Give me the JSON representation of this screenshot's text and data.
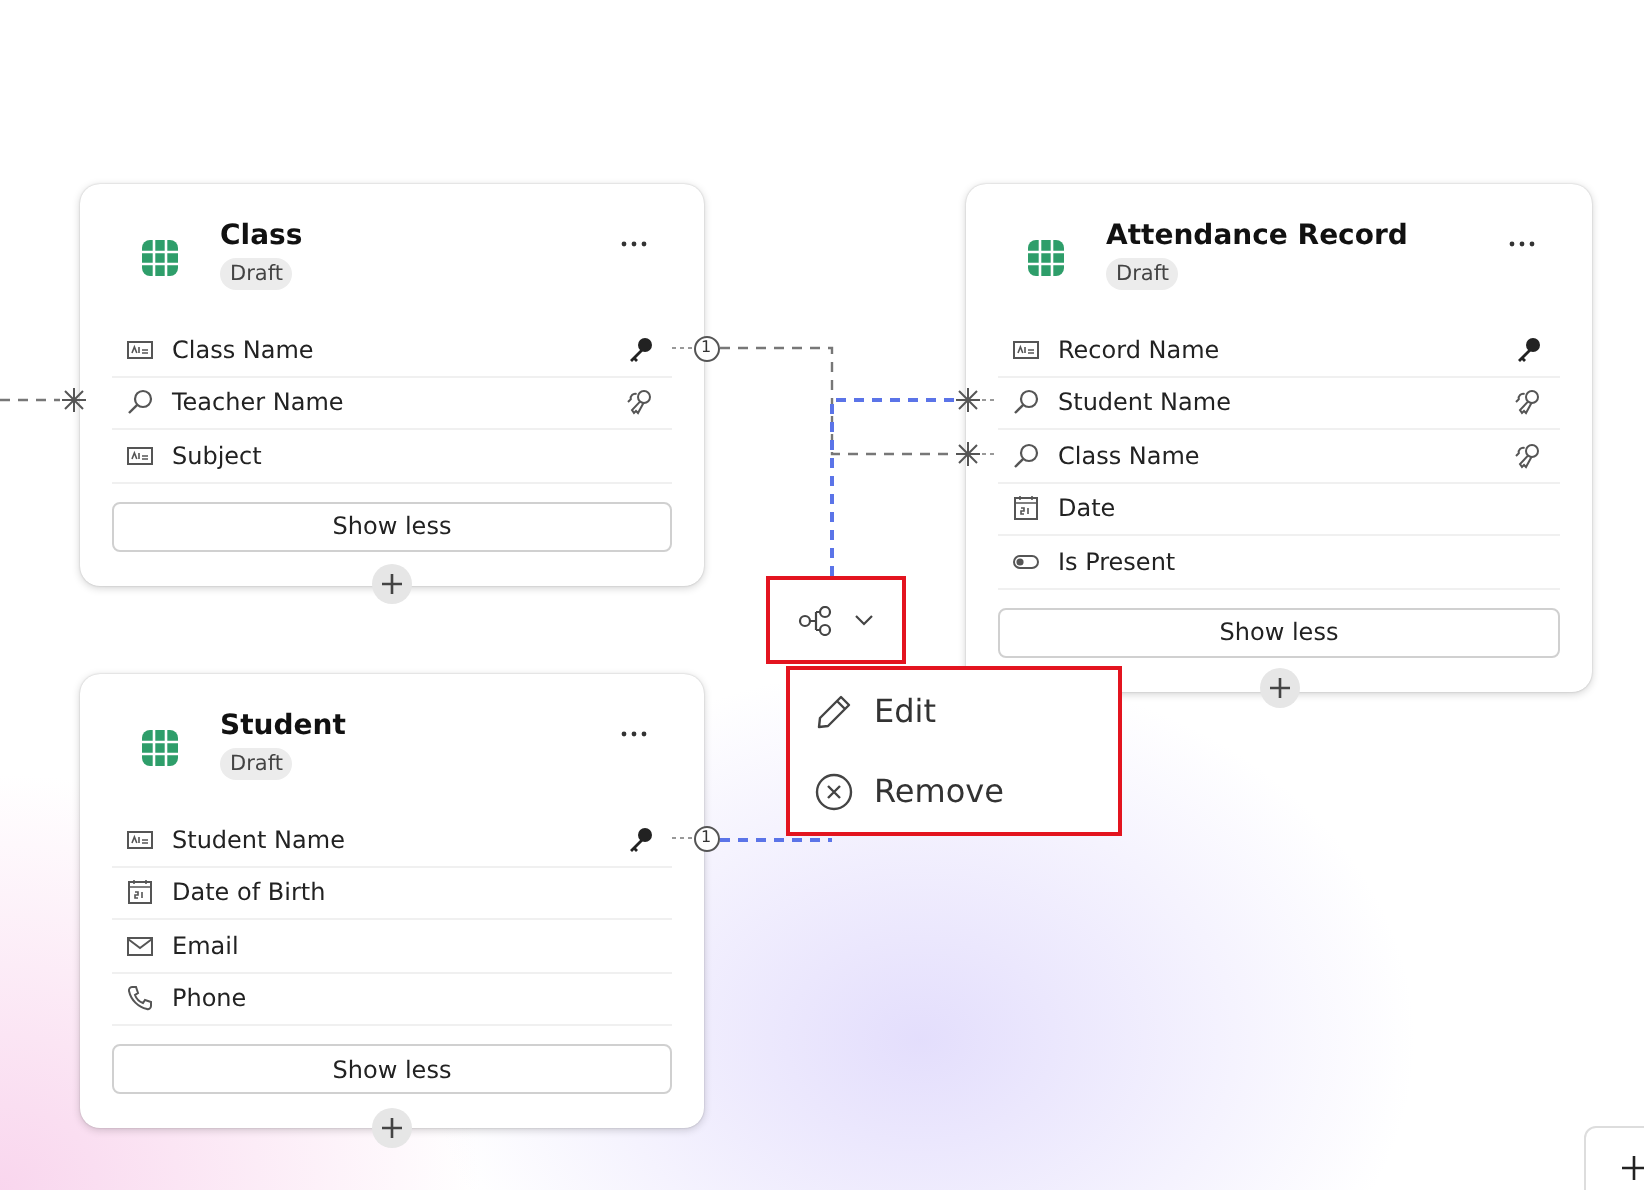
{
  "tables": [
    {
      "title": "Class",
      "status": "Draft",
      "fields": [
        {
          "name": "Class Name",
          "kind": "text",
          "primary_key": true,
          "alternate_key": false
        },
        {
          "name": "Teacher Name",
          "kind": "lookup",
          "primary_key": false,
          "alternate_key": true
        },
        {
          "name": "Subject",
          "kind": "text",
          "primary_key": false,
          "alternate_key": false
        }
      ],
      "toggle_label": "Show less"
    },
    {
      "title": "Attendance Record",
      "status": "Draft",
      "fields": [
        {
          "name": "Record Name",
          "kind": "text",
          "primary_key": true,
          "alternate_key": false
        },
        {
          "name": "Student Name",
          "kind": "lookup",
          "primary_key": false,
          "alternate_key": true
        },
        {
          "name": "Class Name",
          "kind": "lookup",
          "primary_key": false,
          "alternate_key": true
        },
        {
          "name": "Date",
          "kind": "date",
          "primary_key": false,
          "alternate_key": false
        },
        {
          "name": "Is Present",
          "kind": "boolean",
          "primary_key": false,
          "alternate_key": false
        }
      ],
      "toggle_label": "Show less"
    },
    {
      "title": "Student",
      "status": "Draft",
      "fields": [
        {
          "name": "Student Name",
          "kind": "text",
          "primary_key": true,
          "alternate_key": false
        },
        {
          "name": "Date of Birth",
          "kind": "date",
          "primary_key": false,
          "alternate_key": false
        },
        {
          "name": "Email",
          "kind": "email",
          "primary_key": false,
          "alternate_key": false
        },
        {
          "name": "Phone",
          "kind": "phone",
          "primary_key": false,
          "alternate_key": false
        }
      ],
      "toggle_label": "Show less"
    }
  ],
  "relationships": [
    {
      "one_label": "1",
      "selected": false
    },
    {
      "one_label": "1",
      "selected": true
    },
    {
      "selected": false
    }
  ],
  "relationship_menu": {
    "items": [
      {
        "label": "Edit",
        "kind": "edit"
      },
      {
        "label": "Remove",
        "kind": "remove"
      }
    ]
  }
}
